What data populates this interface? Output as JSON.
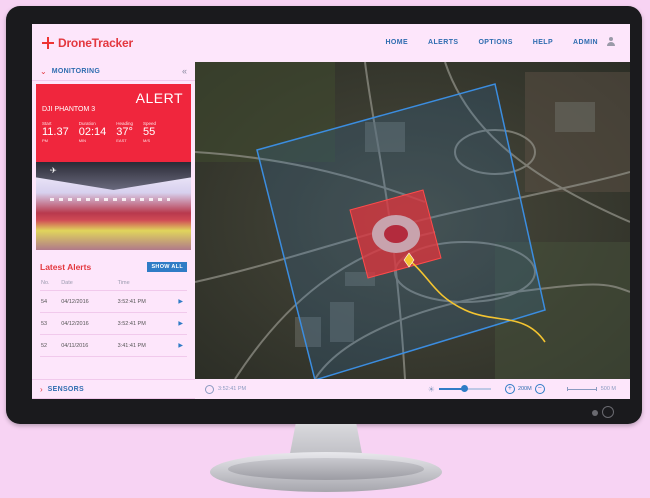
{
  "app": {
    "name": "DroneTracker"
  },
  "nav": {
    "items": [
      "HOME",
      "ALERTS",
      "OPTIONS",
      "HELP",
      "ADMIN"
    ]
  },
  "sidebar": {
    "monitoring_label": "MONITORING",
    "alert": {
      "status": "ALERT",
      "drone": "DJI PHANTOM 3",
      "stats": [
        {
          "label": "Start",
          "value": "11.37",
          "unit": "PM"
        },
        {
          "label": "Duration",
          "value": "02:14",
          "unit": "MIN"
        },
        {
          "label": "Heading",
          "value": "37°",
          "unit": "EAST"
        },
        {
          "label": "Speed",
          "value": "55",
          "unit": "M/S"
        }
      ]
    },
    "latest_alerts": {
      "title": "Latest Alerts",
      "show_all": "SHOW ALL",
      "columns": [
        "No.",
        "Date",
        "Time"
      ],
      "rows": [
        {
          "no": "54",
          "date": "04/12/2016",
          "time": "3:52:41 PM"
        },
        {
          "no": "53",
          "date": "04/12/2016",
          "time": "3:52:41 PM"
        },
        {
          "no": "52",
          "date": "04/11/2016",
          "time": "3:41:41 PM"
        }
      ]
    },
    "sensors_label": "SENSORS"
  },
  "map": {
    "time": "3:52:41 PM",
    "brightness_fraction": 0.5,
    "zoom_label": "200M",
    "scale_label": "500 M"
  },
  "colors": {
    "accent_red": "#f0263d",
    "accent_blue": "#2f7cc6",
    "flight_path": "#f4c430"
  }
}
